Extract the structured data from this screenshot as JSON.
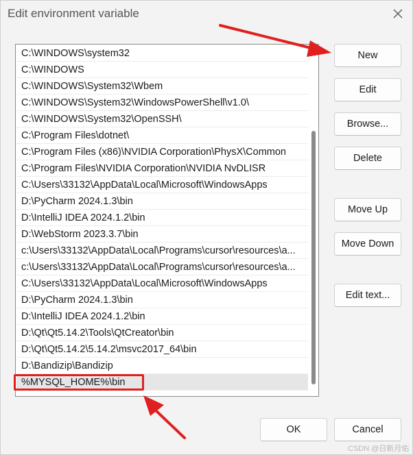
{
  "window": {
    "title": "Edit environment variable",
    "close_icon": "close-icon"
  },
  "paths": [
    "C:\\WINDOWS\\system32",
    "C:\\WINDOWS",
    "C:\\WINDOWS\\System32\\Wbem",
    "C:\\WINDOWS\\System32\\WindowsPowerShell\\v1.0\\",
    "C:\\WINDOWS\\System32\\OpenSSH\\",
    "C:\\Program Files\\dotnet\\",
    "C:\\Program Files (x86)\\NVIDIA Corporation\\PhysX\\Common",
    "C:\\Program Files\\NVIDIA Corporation\\NVIDIA NvDLISR",
    "C:\\Users\\33132\\AppData\\Local\\Microsoft\\WindowsApps",
    "D:\\PyCharm 2024.1.3\\bin",
    "D:\\IntelliJ IDEA 2024.1.2\\bin",
    "D:\\WebStorm 2023.3.7\\bin",
    "c:\\Users\\33132\\AppData\\Local\\Programs\\cursor\\resources\\a...",
    "c:\\Users\\33132\\AppData\\Local\\Programs\\cursor\\resources\\a...",
    "C:\\Users\\33132\\AppData\\Local\\Microsoft\\WindowsApps",
    "D:\\PyCharm 2024.1.3\\bin",
    "D:\\IntelliJ IDEA 2024.1.2\\bin",
    "D:\\Qt\\Qt5.14.2\\Tools\\QtCreator\\bin",
    "D:\\Qt\\Qt5.14.2\\5.14.2\\msvc2017_64\\bin",
    "D:\\Bandizip\\Bandizip",
    "%MYSQL_HOME%\\bin"
  ],
  "selected_index": 20,
  "buttons": {
    "new": "New",
    "edit": "Edit",
    "browse": "Browse...",
    "delete": "Delete",
    "move_up": "Move Up",
    "move_down": "Move Down",
    "edit_text": "Edit text...",
    "ok": "OK",
    "cancel": "Cancel"
  },
  "annotations": {
    "color": "#e02020"
  },
  "watermark": "CSDN @日新月佑"
}
